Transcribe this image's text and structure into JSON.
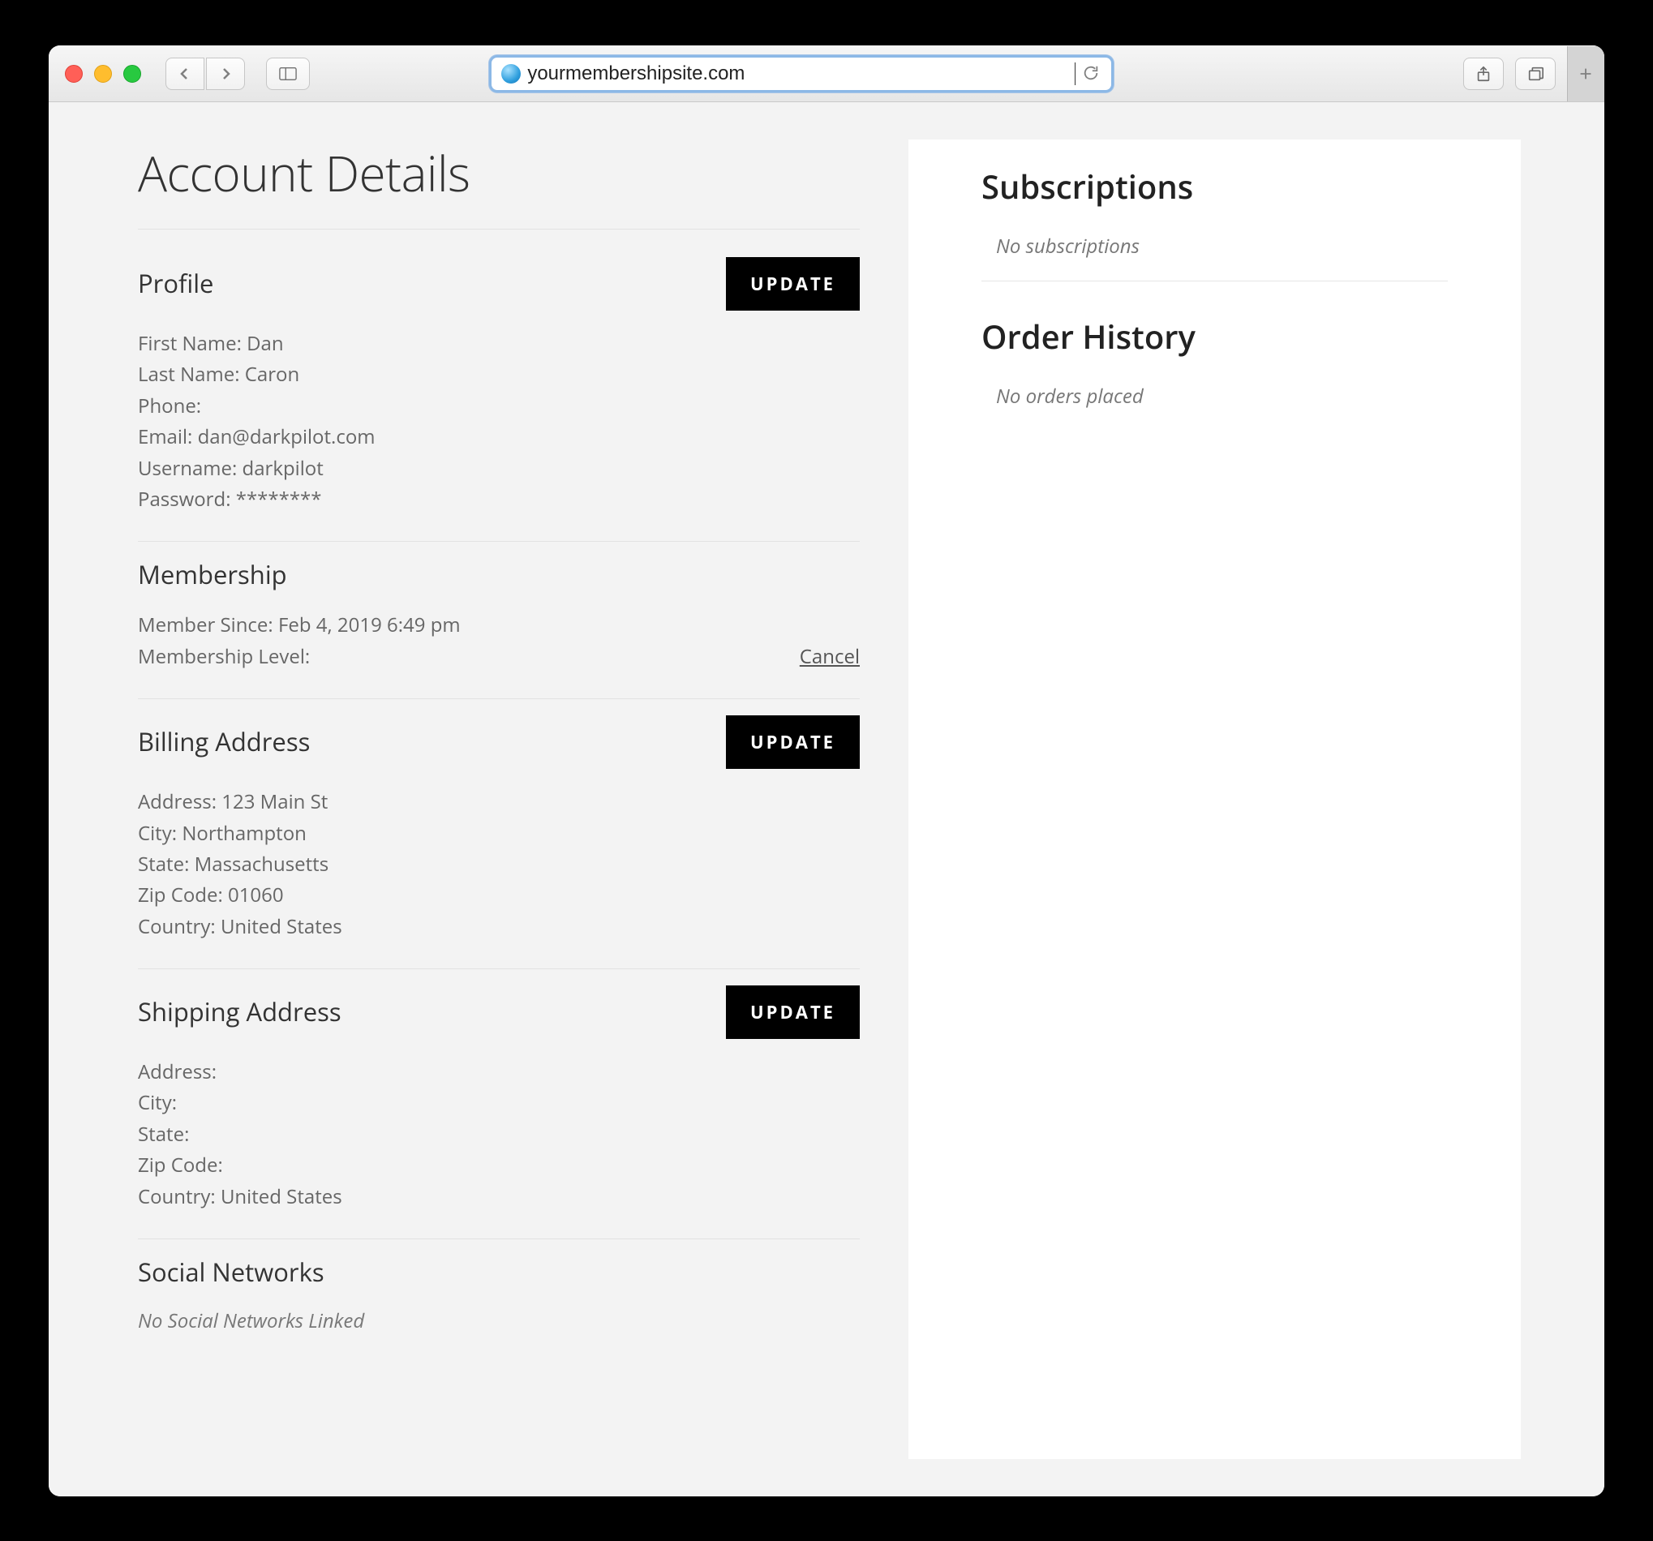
{
  "browser": {
    "url": "yourmembershipsite.com"
  },
  "page": {
    "title": "Account Details"
  },
  "buttons": {
    "update": "UPDATE",
    "cancel": "Cancel"
  },
  "profile": {
    "heading": "Profile",
    "first_name_label": "First Name",
    "first_name": "Dan",
    "last_name_label": "Last Name",
    "last_name": "Caron",
    "phone_label": "Phone",
    "phone": "",
    "email_label": "Email",
    "email": "dan@darkpilot.com",
    "username_label": "Username",
    "username": "darkpilot",
    "password_label": "Password",
    "password": "********"
  },
  "membership": {
    "heading": "Membership",
    "since_label": "Member Since",
    "since": "Feb 4, 2019 6:49 pm",
    "level_label": "Membership Level",
    "level": ""
  },
  "billing": {
    "heading": "Billing Address",
    "address_label": "Address",
    "address": "123 Main St",
    "city_label": "City",
    "city": "Northampton",
    "state_label": "State",
    "state": "Massachusetts",
    "zip_label": "Zip Code",
    "zip": "01060",
    "country_label": "Country",
    "country": "United States"
  },
  "shipping": {
    "heading": "Shipping Address",
    "address_label": "Address",
    "address": "",
    "city_label": "City",
    "city": "",
    "state_label": "State",
    "state": "",
    "zip_label": "Zip Code",
    "zip": "",
    "country_label": "Country",
    "country": "United States"
  },
  "social": {
    "heading": "Social Networks",
    "empty": "No Social Networks Linked"
  },
  "sidebar": {
    "subscriptions": {
      "heading": "Subscriptions",
      "empty": "No subscriptions"
    },
    "orders": {
      "heading": "Order History",
      "empty": "No orders placed"
    }
  }
}
